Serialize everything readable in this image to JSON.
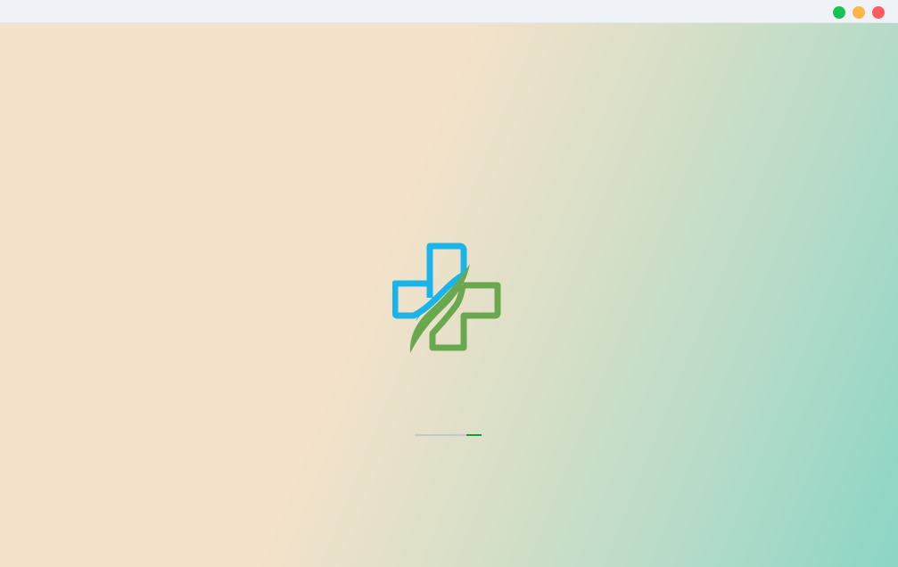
{
  "window": {
    "title": "",
    "controls": [
      {
        "name": "maximize-button",
        "icon": "green-circle",
        "color": "#1ac153"
      },
      {
        "name": "minimize-button",
        "icon": "yellow-circle",
        "color": "#fdb54a"
      },
      {
        "name": "close-button",
        "icon": "red-circle",
        "color": "#fd5d5d"
      }
    ]
  },
  "splash": {
    "logo_icon": "medical-cross-icon",
    "logo_colors": {
      "primary": "#1ab4e8",
      "secondary": "#6aa84f"
    },
    "progress": {
      "indeterminate": true,
      "segment_start": 0.77,
      "segment_end": 1.0,
      "track_color": "#c4c8c8",
      "fill_color": "#17a035"
    }
  }
}
